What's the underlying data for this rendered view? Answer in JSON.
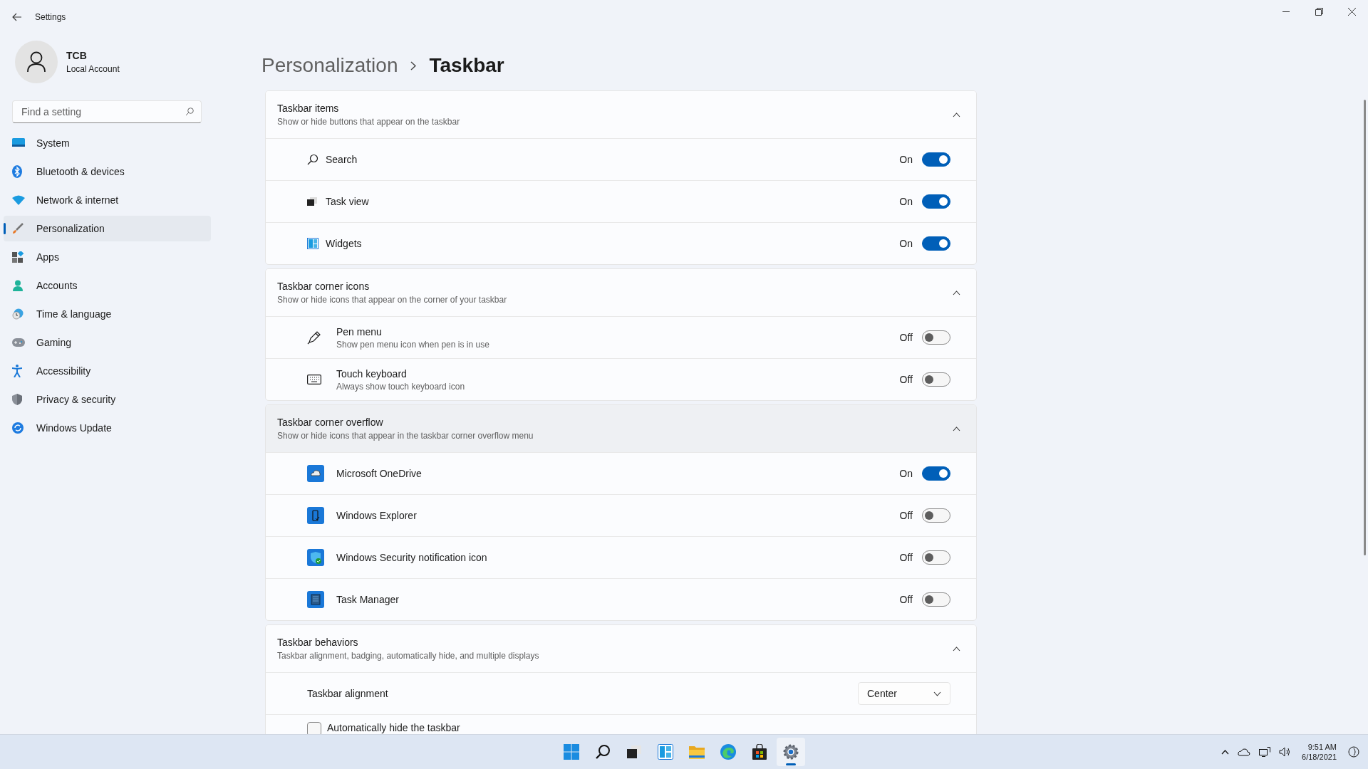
{
  "window": {
    "title": "Settings"
  },
  "account": {
    "name": "TCB",
    "type": "Local Account"
  },
  "search": {
    "placeholder": "Find a setting"
  },
  "nav": [
    {
      "label": "System",
      "selected": false
    },
    {
      "label": "Bluetooth & devices",
      "selected": false
    },
    {
      "label": "Network & internet",
      "selected": false
    },
    {
      "label": "Personalization",
      "selected": true
    },
    {
      "label": "Apps",
      "selected": false
    },
    {
      "label": "Accounts",
      "selected": false
    },
    {
      "label": "Time & language",
      "selected": false
    },
    {
      "label": "Gaming",
      "selected": false
    },
    {
      "label": "Accessibility",
      "selected": false
    },
    {
      "label": "Privacy & security",
      "selected": false
    },
    {
      "label": "Windows Update",
      "selected": false
    }
  ],
  "breadcrumb": [
    "Personalization",
    "Taskbar"
  ],
  "sections": [
    {
      "title": "Taskbar items",
      "description": "Show or hide buttons that appear on the taskbar",
      "expanded": true,
      "hovered": false,
      "rows": [
        {
          "kind": "toggle",
          "label": "Search",
          "on": true,
          "state_label": "On"
        },
        {
          "kind": "toggle",
          "label": "Task view",
          "on": true,
          "state_label": "On"
        },
        {
          "kind": "toggle",
          "label": "Widgets",
          "on": true,
          "state_label": "On"
        }
      ]
    },
    {
      "title": "Taskbar corner icons",
      "description": "Show or hide icons that appear on the corner of your taskbar",
      "expanded": true,
      "hovered": false,
      "rows": [
        {
          "kind": "toggle",
          "label": "Pen menu",
          "description": "Show pen menu icon when pen is in use",
          "on": false,
          "state_label": "Off"
        },
        {
          "kind": "toggle",
          "label": "Touch keyboard",
          "description": "Always show touch keyboard icon",
          "on": false,
          "state_label": "Off"
        }
      ]
    },
    {
      "title": "Taskbar corner overflow",
      "description": "Show or hide icons that appear in the taskbar corner overflow menu",
      "expanded": true,
      "hovered": true,
      "rows": [
        {
          "kind": "toggle",
          "label": "Microsoft OneDrive",
          "on": true,
          "state_label": "On"
        },
        {
          "kind": "toggle",
          "label": "Windows Explorer",
          "on": false,
          "state_label": "Off"
        },
        {
          "kind": "toggle",
          "label": "Windows Security notification icon",
          "on": false,
          "state_label": "Off"
        },
        {
          "kind": "toggle",
          "label": "Task Manager",
          "on": false,
          "state_label": "Off"
        }
      ]
    },
    {
      "title": "Taskbar behaviors",
      "description": "Taskbar alignment, badging, automatically hide, and multiple displays",
      "expanded": true,
      "hovered": false,
      "rows": [
        {
          "kind": "dropdown",
          "label": "Taskbar alignment",
          "value": "Center"
        },
        {
          "kind": "checkbox",
          "label": "Automatically hide the taskbar",
          "checked": false
        }
      ]
    }
  ],
  "taskbar_apps": [
    {
      "selected": false
    },
    {
      "selected": false
    },
    {
      "selected": false
    },
    {
      "selected": false
    },
    {
      "selected": false
    },
    {
      "selected": false
    },
    {
      "selected": false
    },
    {
      "selected": true
    }
  ],
  "clock": {
    "time": "9:51 AM",
    "date": "6/18/2021"
  }
}
